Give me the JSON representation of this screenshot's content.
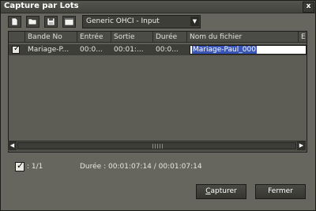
{
  "window": {
    "title": "Capture par Lots"
  },
  "titlebar": {
    "close_label": "x"
  },
  "toolbar": {
    "device_selected": "Generic OHCI - Input"
  },
  "table": {
    "columns": [
      "Bande No",
      "Entrée",
      "Sortie",
      "Durée",
      "Nom du fichier",
      "E"
    ],
    "rows": [
      {
        "checked": true,
        "tape": "Mariage-P...",
        "in": "00:0...",
        "out": "00:01:...",
        "duration": "00:0...",
        "filename": "Mariage-Paul_000"
      }
    ]
  },
  "status": {
    "count": ": 1/1",
    "duration_label": "Durée :",
    "duration_value": "00:01:07:14 / 00:01:07:14"
  },
  "buttons": {
    "capture_first": "C",
    "capture_rest": "apturer",
    "close": "Fermer"
  }
}
